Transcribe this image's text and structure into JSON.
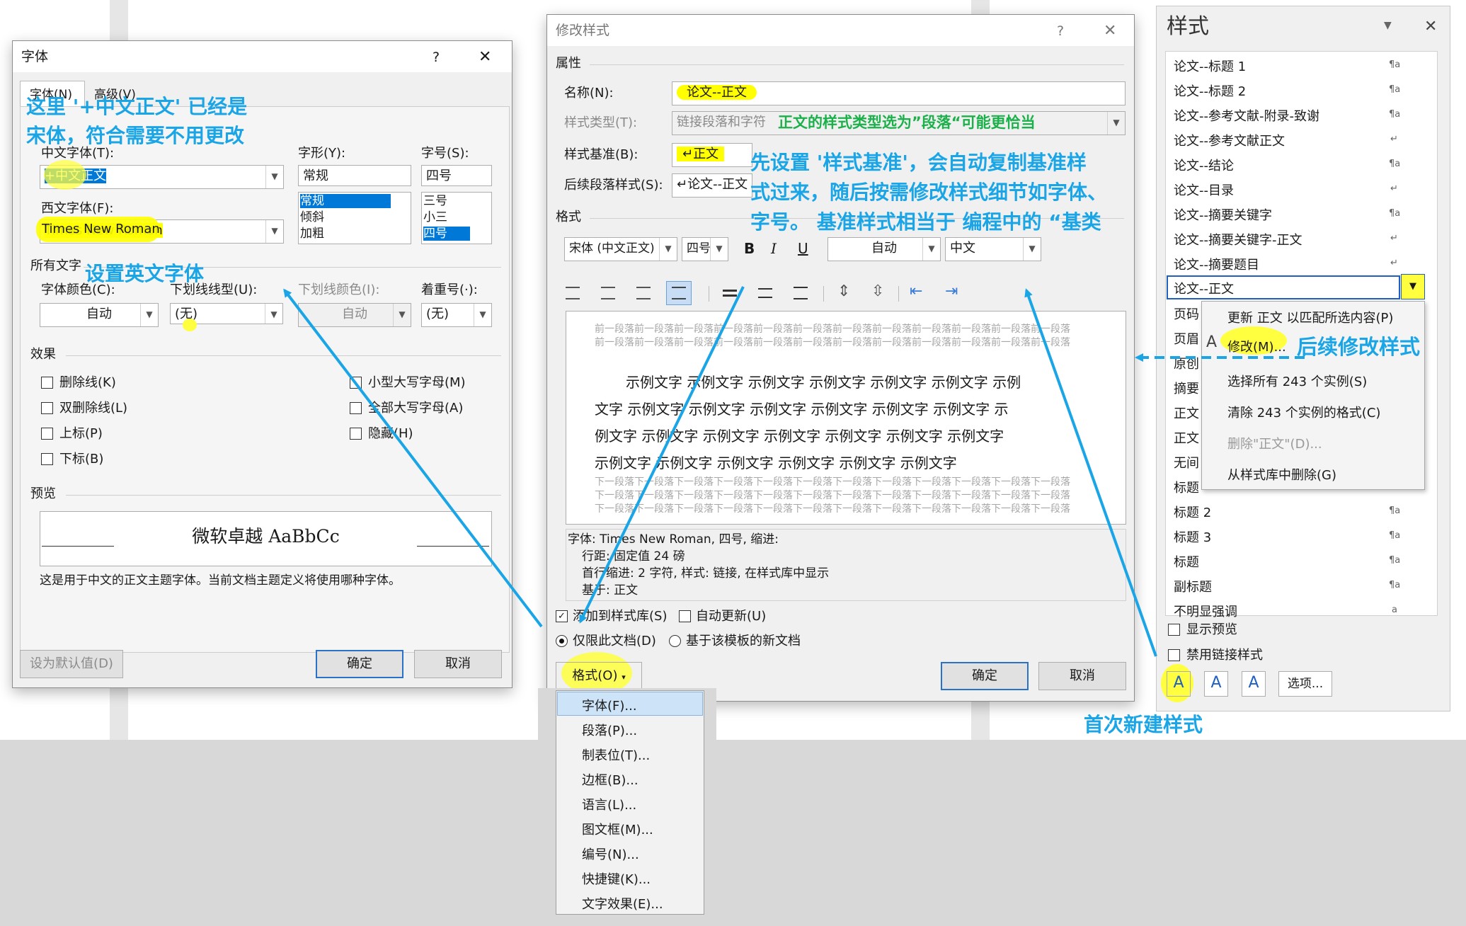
{
  "font_dialog": {
    "title": "字体",
    "help": "?",
    "close": "✕",
    "tab_font": "字体(N)",
    "tab_advanced": "高级(V)",
    "cn_font_label": "中文字体(T):",
    "cn_font_value": "+中文正文",
    "west_font_label": "西文字体(F):",
    "west_font_value": "Times New Roman",
    "style_label": "字形(Y):",
    "style_value": "常规",
    "style_options": [
      "常规",
      "倾斜",
      "加粗"
    ],
    "size_label": "字号(S):",
    "size_value": "四号",
    "size_options": [
      "三号",
      "小三",
      "四号"
    ],
    "all_text": "所有文字",
    "color_label": "字体颜色(C):",
    "color_value": "自动",
    "underline_label": "下划线线型(U):",
    "underline_value": "(无)",
    "ucolor_label": "下划线颜色(I):",
    "ucolor_value": "自动",
    "emph_label": "着重号(·):",
    "emph_value": "(无)",
    "effects": "效果",
    "strike": "删除线(K)",
    "dstrike": "双删除线(L)",
    "sup": "上标(P)",
    "sub": "下标(B)",
    "smallcaps": "小型大写字母(M)",
    "allcaps": "全部大写字母(A)",
    "hidden": "隐藏(H)",
    "preview": "预览",
    "preview_text": "微软卓越 AaBbCc",
    "note": "这是用于中文的正文主题字体。当前文档主题定义将使用哪种字体。",
    "set_default": "设为默认值(D)",
    "ok": "确定",
    "cancel": "取消"
  },
  "modify_dialog": {
    "title": "修改样式",
    "help": "?",
    "close": "✕",
    "properties": "属性",
    "name_label": "名称(N):",
    "name_value": "论文--正文",
    "type_label": "样式类型(T):",
    "type_value": "链接段落和字符",
    "based_label": "样式基准(B):",
    "based_value": "↵正文",
    "next_label": "后续段落样式(S):",
    "next_value": "↵论文--正文",
    "format": "格式",
    "font_value": "宋体 (中文正文)",
    "size_value": "四号",
    "bold": "B",
    "italic": "I",
    "underline": "U",
    "color_value": "自动",
    "lang_value": "中文",
    "prev_para": "前一段落前一段落前一段落前一段落前一段落前一段落前一段落前一段落前一段落前一段落前一段落前一段落前一段落前一段落前一段落前一段落前一段落前一段落前一段落前一段落前一段落前一段落前一段落前一段落",
    "sample_lines": [
      "示例文字 示例文字 示例文字 示例文字 示例文字 示例文字 示例",
      "文字 示例文字 示例文字 示例文字 示例文字 示例文字 示例文字 示",
      "例文字 示例文字 示例文字 示例文字 示例文字 示例文字 示例文字",
      "示例文字 示例文字 示例文字 示例文字 示例文字 示例文字"
    ],
    "next_para": "下一段落下一段落下一段落下一段落下一段落下一段落下一段落下一段落下一段落下一段落下一段落下一段落下一段落下一段落下一段落下一段落下一段落下一段落下一段落下一段落下一段落下一段落下一段落下一段落下一段落下一段落下一段落下一段落下一段落下一段落下一段落下一段落下一段落下一段落下一段落下一段落",
    "desc": [
      "字体: Times New Roman, 四号, 缩进:",
      "行距: 固定值 24 磅",
      "首行缩进: 2 字符, 样式: 链接, 在样式库中显示",
      "基于: 正文"
    ],
    "add_gallery": "添加到样式库(S)",
    "auto_update": "自动更新(U)",
    "only_doc": "仅限此文档(D)",
    "new_docs": "基于该模板的新文档",
    "format_btn": "格式(O)",
    "ok": "确定",
    "cancel": "取消"
  },
  "format_menu": [
    "字体(F)...",
    "段落(P)...",
    "制表位(T)...",
    "边框(B)...",
    "语言(L)...",
    "图文框(M)...",
    "编号(N)...",
    "快捷键(K)...",
    "文字效果(E)..."
  ],
  "styles_pane": {
    "title": "样式",
    "items": [
      "论文--标题 1",
      "论文--标题 2",
      "论文--参考文献-附录-致谢",
      "论文--参考文献正文",
      "论文--结论",
      "论文--目录",
      "论文--摘要关键字",
      "论文--摘要关键字-正文",
      "论文--摘要题目",
      "论文--正文"
    ],
    "items_lower": [
      "页码",
      "页眉",
      "原创",
      "摘要",
      "正文",
      "正文",
      "无间",
      "标题"
    ],
    "items_bottom": [
      "标题 2",
      "标题 3",
      "标题",
      "副标题",
      "不明显强调"
    ],
    "show_preview": "显示预览",
    "disable_linked": "禁用链接样式",
    "options": "选项..."
  },
  "context_menu": [
    "更新 正文 以匹配所选内容(P)",
    "修改(M)...",
    "选择所有 243 个实例(S)",
    "清除 243 个实例的格式(C)",
    "删除\"正文\"(D)...",
    "从样式库中删除(G)"
  ],
  "annotations": {
    "a1": "这里 '+中文正文' 已经是",
    "a2": "宋体，符合需要不用更改",
    "a3": "设置英文字体",
    "a4": "正文的样式类型选为”段落“可能更恰当",
    "a5": "先设置 '样式基准'，会自动复制基准样",
    "a6": "式过来，随后按需修改样式细节如字体、",
    "a7": "字号。 基准样式相当于 编程中的 “基类",
    "a8": "后续修改样式",
    "a9": "首次新建样式"
  },
  "colors": {
    "annotation": "#1aa5e6",
    "highlight": "#ffff00",
    "green_note": "#1cb04a",
    "accent": "#0078d7"
  }
}
